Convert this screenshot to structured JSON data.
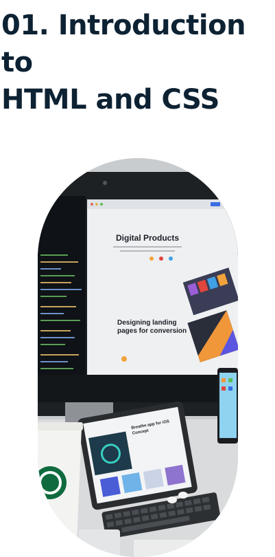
{
  "lesson": {
    "title": "01. Introduction to\nHTML and CSS"
  },
  "hero_image": {
    "icon": "workspace-photo",
    "monitor_heading": "Digital Products",
    "monitor_tagline": "Designing landing\npages for conversion",
    "tablet_heading": "Breathe app for iOS\nConcept"
  }
}
